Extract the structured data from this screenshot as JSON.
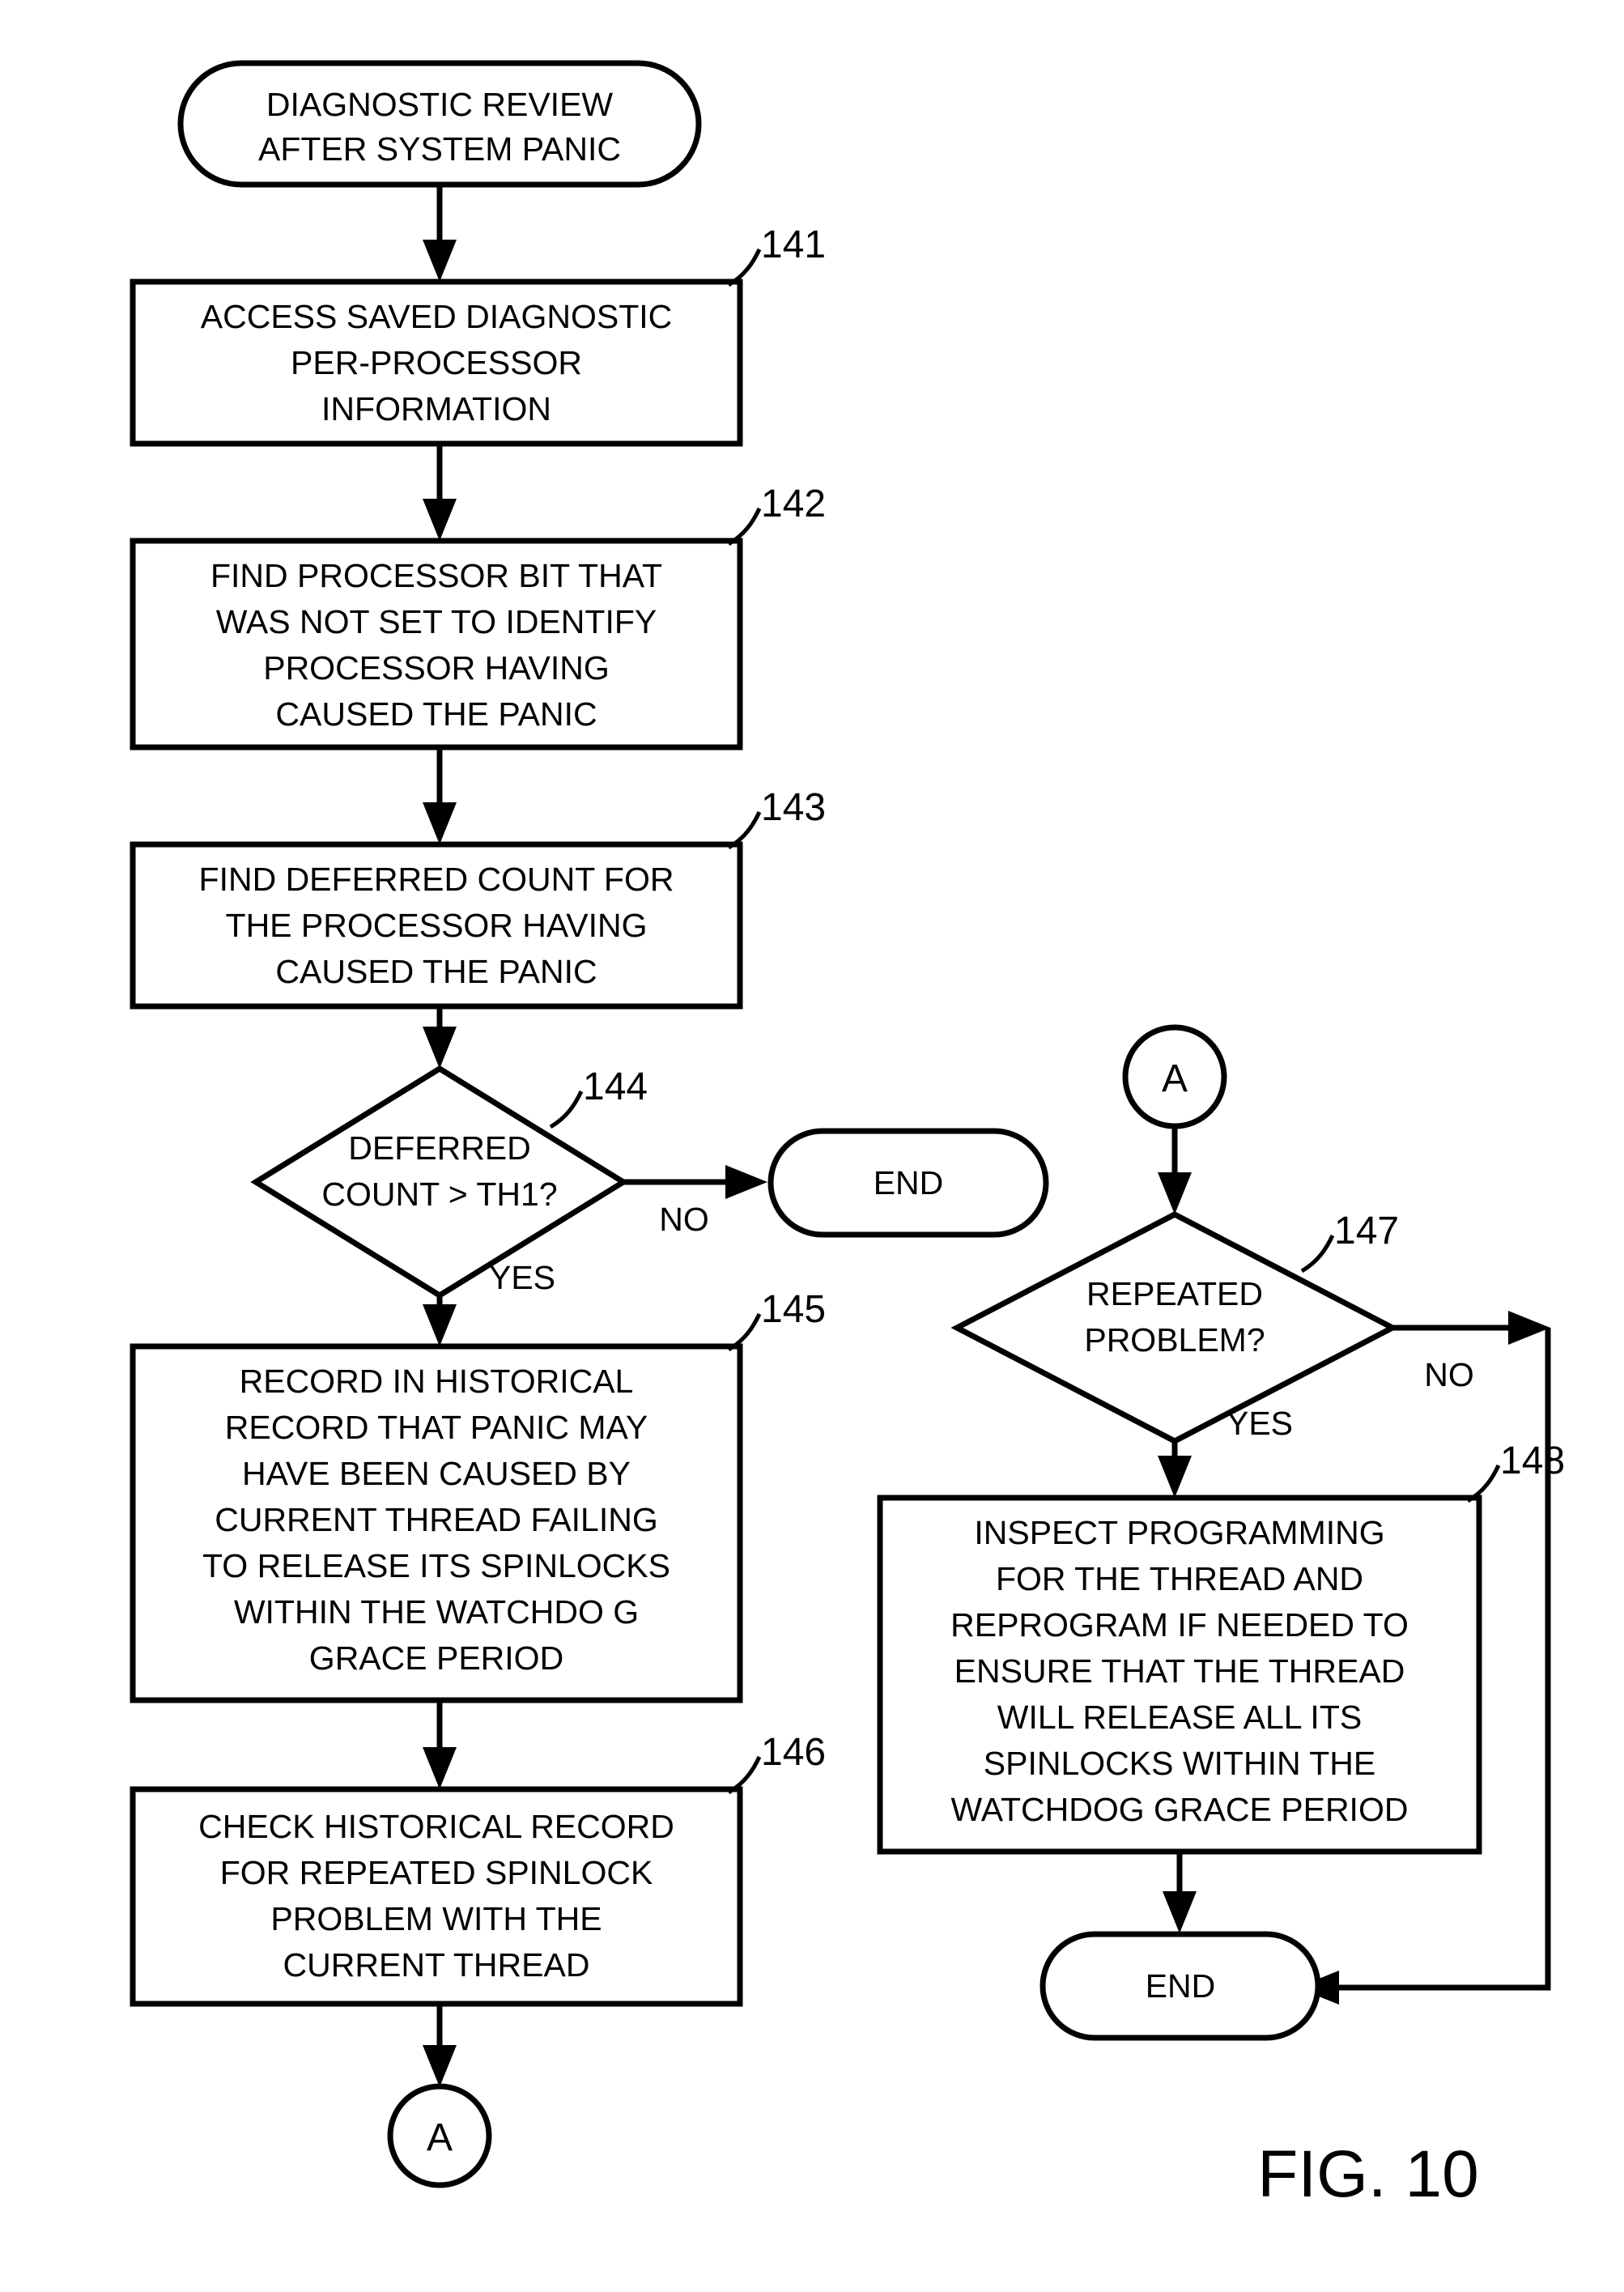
{
  "figure": {
    "label": "FIG. 10",
    "title_node": {
      "type": "terminal",
      "lines": [
        "DIAGNOSTIC REVIEW",
        "AFTER SYSTEM PANIC"
      ]
    }
  },
  "nodes": {
    "start": {
      "shape": "rounded-terminal",
      "line1": "DIAGNOSTIC REVIEW",
      "line2": "AFTER SYSTEM PANIC"
    },
    "step141": {
      "ref": "141",
      "shape": "process",
      "line1": "ACCESS SAVED DIAGNOSTIC",
      "line2": "PER-PROCESSOR",
      "line3": "INFORMATION"
    },
    "step142": {
      "ref": "142",
      "shape": "process",
      "line1": "FIND PROCESSOR BIT THAT",
      "line2": "WAS NOT SET TO IDENTIFY",
      "line3": "PROCESSOR HAVING",
      "line4": "CAUSED THE PANIC"
    },
    "step143": {
      "ref": "143",
      "shape": "process",
      "line1": "FIND DEFERRED COUNT FOR",
      "line2": "THE PROCESSOR HAVING",
      "line3": "CAUSED THE PANIC"
    },
    "decision144": {
      "ref": "144",
      "shape": "decision",
      "line1": "DEFERRED",
      "line2": "COUNT > TH1?",
      "yes_label": "YES",
      "no_label": "NO"
    },
    "end1": {
      "shape": "rounded-terminal",
      "label": "END"
    },
    "step145": {
      "ref": "145",
      "shape": "process",
      "line1": "RECORD IN HISTORICAL",
      "line2": "RECORD THAT PANIC MAY",
      "line3": "HAVE BEEN CAUSED BY",
      "line4": "CURRENT THREAD FAILING",
      "line5": "TO RELEASE ITS SPINLOCKS",
      "line6": "WITHIN THE WATCHDO G",
      "line7": "GRACE PERIOD"
    },
    "step146": {
      "ref": "146",
      "shape": "process",
      "line1": "CHECK HISTORICAL RECORD",
      "line2": "FOR REPEATED SPINLOCK",
      "line3": "PROBLEM WITH THE",
      "line4": "CURRENT THREAD"
    },
    "connector_a_bottom": {
      "shape": "circle-connector",
      "label": "A"
    },
    "connector_a_top": {
      "shape": "circle-connector",
      "label": "A"
    },
    "decision147": {
      "ref": "147",
      "shape": "decision",
      "line1": "REPEATED",
      "line2": "PROBLEM?",
      "yes_label": "YES",
      "no_label": "NO"
    },
    "step148": {
      "ref": "148",
      "shape": "process",
      "line1": "INSPECT PROGRAMMING",
      "line2": "FOR THE THREAD AND",
      "line3": "REPROGRAM IF NEEDED TO",
      "line4": "ENSURE THAT THE THREAD",
      "line5": "WILL RELEASE ALL ITS",
      "line6": "SPINLOCKS WITHIN THE",
      "line7": "WATCHDOG GRACE PERIOD"
    },
    "end2": {
      "shape": "rounded-terminal",
      "label": "END"
    }
  },
  "colors": {
    "ink": "#000000",
    "paper": "#ffffff"
  }
}
